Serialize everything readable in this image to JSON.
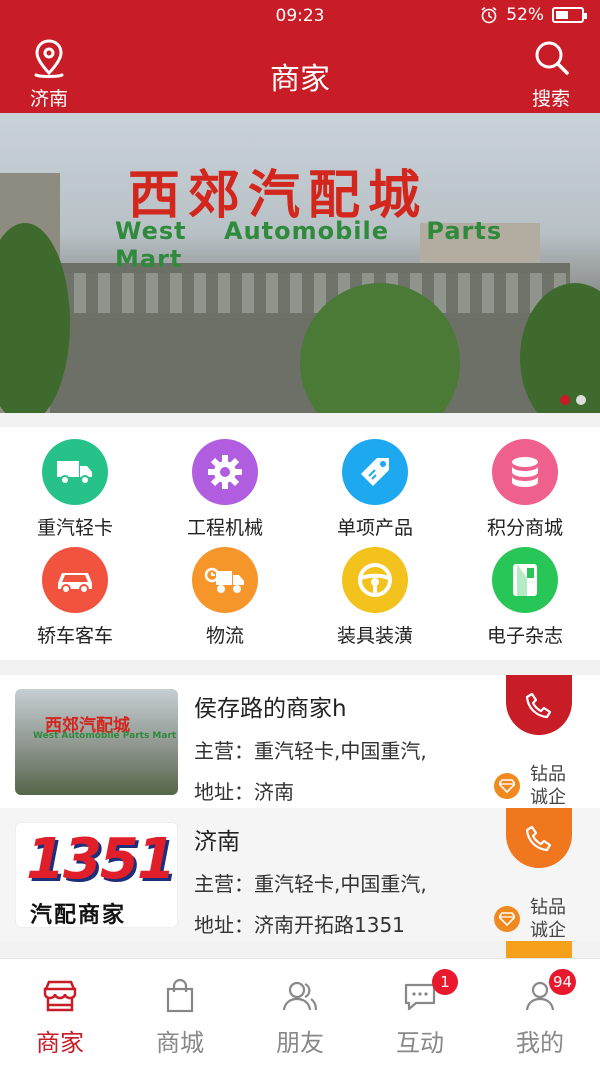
{
  "status_bar": {
    "time": "09:23",
    "battery": "52%",
    "battery_level": 0.52
  },
  "header": {
    "title": "商家",
    "location_label": "济南",
    "search_label": "搜索"
  },
  "banner": {
    "sign_cn": "西郊汽配城",
    "sign_en": "West Automobile Parts Mart",
    "slide_count": 2,
    "active_slide": 1
  },
  "categories": [
    {
      "label": "重汽轻卡",
      "icon": "truck-icon",
      "color": "#26c28a"
    },
    {
      "label": "工程机械",
      "icon": "gear-icon",
      "color": "#b05de0"
    },
    {
      "label": "单项产品",
      "icon": "tag-icon",
      "color": "#1da8f0"
    },
    {
      "label": "积分商城",
      "icon": "database-icon",
      "color": "#f0608c"
    },
    {
      "label": "轿车客车",
      "icon": "car-icon",
      "color": "#f2533f"
    },
    {
      "label": "物流",
      "icon": "delivery-truck-icon",
      "color": "#f6962a"
    },
    {
      "label": "装具装潢",
      "icon": "steering-wheel-icon",
      "color": "#f4c21c"
    },
    {
      "label": "电子杂志",
      "icon": "magazine-icon",
      "color": "#27c657"
    }
  ],
  "shops": [
    {
      "name": "侯存路的商家h",
      "main_business": "主营：重汽轻卡,中国重汽,",
      "address": "地址：济南",
      "badge": "钻品诚企",
      "call_color": "#c81c27",
      "thumb_cn": "西郊汽配城",
      "thumb_en": "West Automobile Parts Mart"
    },
    {
      "name": "济南",
      "main_business": "主营：重汽轻卡,中国重汽,",
      "address": "地址：济南开拓路1351",
      "badge": "钻品诚企",
      "call_color": "#f0771e",
      "thumb_num": "1351",
      "thumb_cn": "汽配商家"
    }
  ],
  "tabs": [
    {
      "label": "商家",
      "icon": "shop-icon",
      "active": true
    },
    {
      "label": "商城",
      "icon": "shopping-bag-icon"
    },
    {
      "label": "朋友",
      "icon": "friends-icon"
    },
    {
      "label": "互动",
      "icon": "chat-icon",
      "badge": "1"
    },
    {
      "label": "我的",
      "icon": "user-icon",
      "badge": "94"
    }
  ],
  "colors": {
    "brand_red": "#c81c27",
    "background": "#f2f2f2"
  }
}
